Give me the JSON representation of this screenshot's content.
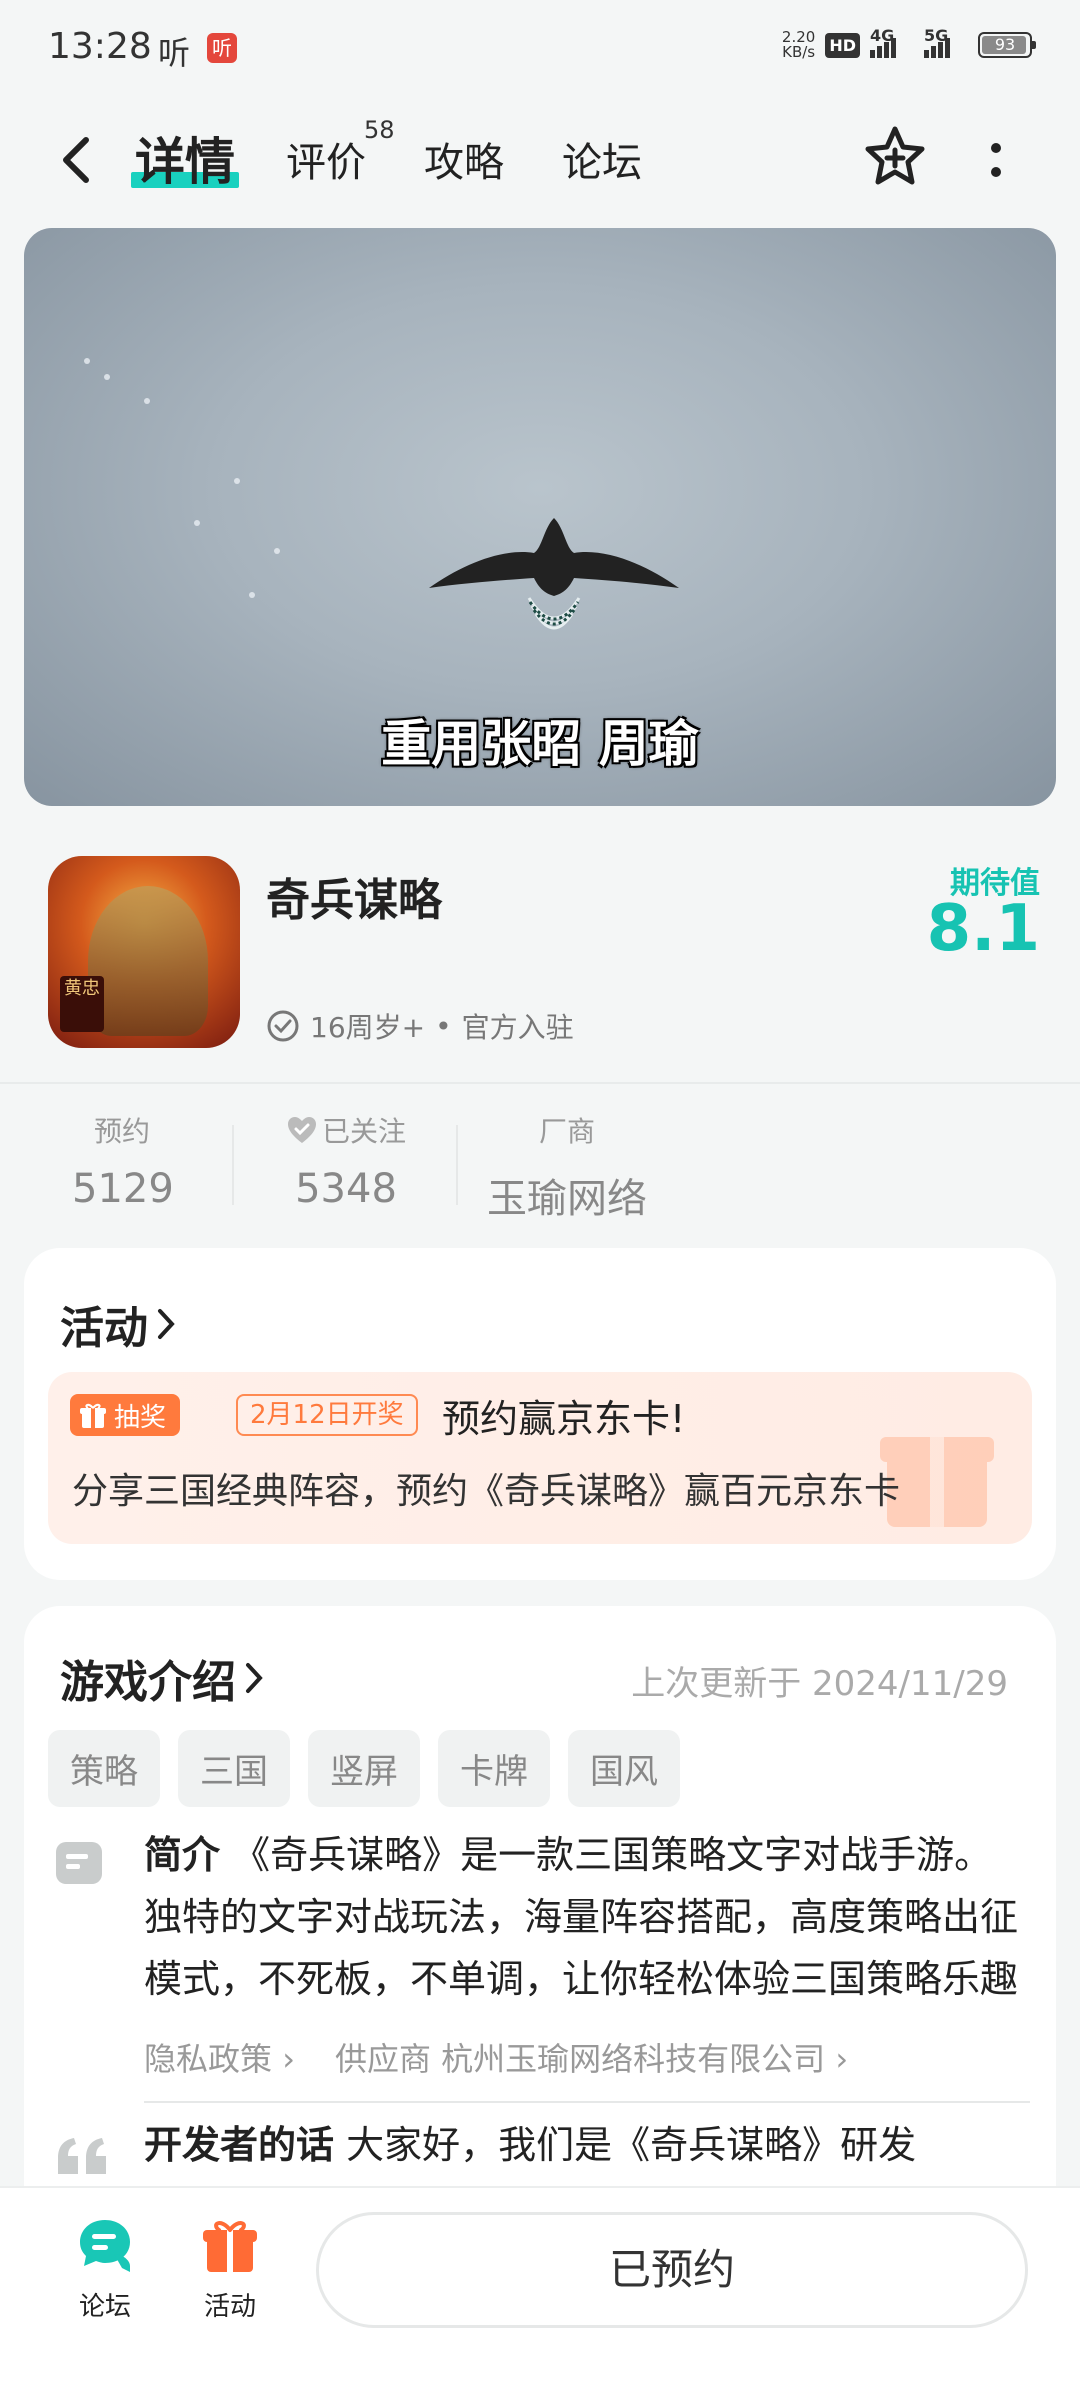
{
  "status_bar": {
    "time": "13:28",
    "listen_label": "听",
    "listen_badge": "听",
    "net_speed_value": "2.20",
    "net_speed_unit": "KB/s",
    "hd_label": "HD",
    "signal_1_label": "4G",
    "signal_2_label": "5G",
    "battery": "93"
  },
  "nav": {
    "tabs": [
      {
        "label": "详情",
        "active": true
      },
      {
        "label": "评价",
        "badge": "58"
      },
      {
        "label": "攻略"
      },
      {
        "label": "论坛"
      }
    ],
    "icons": [
      "back-icon",
      "star-add-icon",
      "more-icon"
    ]
  },
  "banner": {
    "caption": "重用张昭 周瑜"
  },
  "game": {
    "title": "奇兵谋略",
    "age": "16周岁+",
    "separator": "•",
    "official": "官方入驻",
    "icon_seal": "黄忠",
    "expect_label": "期待值",
    "expect_value": "8.1"
  },
  "stats": [
    {
      "label": "预约",
      "value": "5129"
    },
    {
      "label": "已关注",
      "value": "5348",
      "icon": "heart-icon"
    },
    {
      "label": "厂商",
      "value": "玉瑜网络"
    }
  ],
  "activity": {
    "heading": "活动",
    "badge": "抽奖",
    "date": "2月12日开奖",
    "title": "预约赢京东卡!",
    "desc": "分享三国经典阵容，预约《奇兵谋略》赢百元京东卡"
  },
  "intro": {
    "heading": "游戏介绍",
    "updated": "上次更新于 2024/11/29",
    "tags": [
      "策略",
      "三国",
      "竖屏",
      "卡牌",
      "国风"
    ],
    "summary_label": "简介",
    "summary": "《奇兵谋略》是一款三国策略文字对战手游。独特的文字对战玩法，海量阵容搭配，高度策略出征模式，不死板，不单调，让你轻松体验三国策略乐趣",
    "privacy_link": "隐私政策",
    "supplier_label": "供应商",
    "supplier": "杭州玉瑜网络科技有限公司",
    "dev_label": "开发者的话",
    "dev_text": "大家好，我们是《奇兵谋略》研发"
  },
  "bottom_bar": {
    "forum_label": "论坛",
    "activity_label": "活动",
    "reserve_button": "已预约"
  },
  "colors": {
    "accent": "#19d1bf",
    "expect": "#17c3b2",
    "lottery": "#ff7a3d",
    "background": "#f4f6f6"
  }
}
